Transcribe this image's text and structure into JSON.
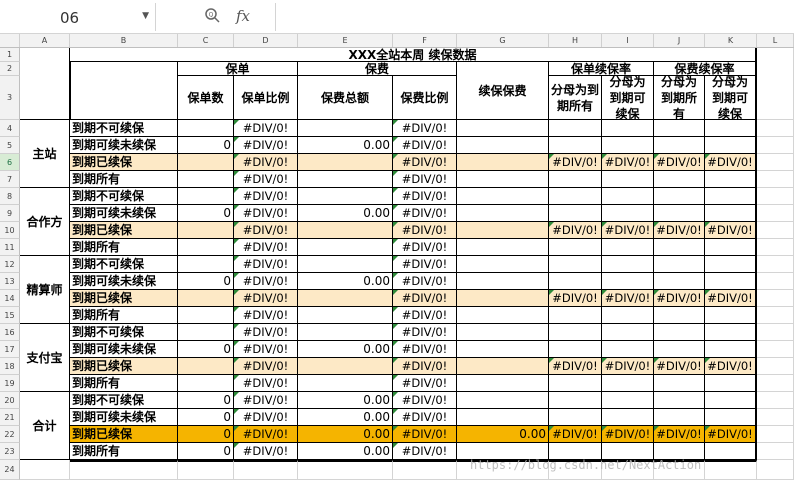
{
  "formula_bar": {
    "name_box": "06",
    "fx": "fx",
    "formula": ""
  },
  "columns": [
    "A",
    "B",
    "C",
    "D",
    "E",
    "F",
    "G",
    "H",
    "I",
    "J",
    "K",
    "L"
  ],
  "rows": [
    "1",
    "2",
    "3",
    "4",
    "5",
    "6",
    "7",
    "8",
    "9",
    "10",
    "11",
    "12",
    "13",
    "14",
    "15",
    "16",
    "17",
    "18",
    "19",
    "20",
    "21",
    "22",
    "23",
    "24"
  ],
  "sheet": {
    "title": "XXX全站本周 续保数据",
    "headers": {
      "baodan": "保单",
      "baofei": "保费",
      "xubao_baofei": "续保保费",
      "baodan_xubaolv": "保单续保率",
      "baofei_xubaolv": "保费续保率",
      "baodan_shu": "保单数",
      "baodan_bili": "保单比例",
      "baofei_zonge": "保费总额",
      "baofei_bili": "保费比例",
      "h_sub": "分母为到期所有",
      "i_sub": "分母为到期可续保",
      "j_sub": "分母为到期所有",
      "k_sub": "分母为到期可续保"
    },
    "groups": [
      {
        "name": "主站",
        "rows": [
          "到期不可续保",
          "到期可续未续保",
          "到期已续保",
          "到期所有"
        ]
      },
      {
        "name": "合作方",
        "rows": [
          "到期不可续保",
          "到期可续未续保",
          "到期已续保",
          "到期所有"
        ]
      },
      {
        "name": "精算师",
        "rows": [
          "到期不可续保",
          "到期可续未续保",
          "到期已续保",
          "到期所有"
        ]
      },
      {
        "name": "支付宝",
        "rows": [
          "到期不可续保",
          "到期可续未续保",
          "到期已续保",
          "到期所有"
        ]
      },
      {
        "name": "合计",
        "rows": [
          "到期不可续保",
          "到期可续未续保",
          "到期已续保",
          "到期所有"
        ]
      }
    ],
    "err": "#DIV/0!",
    "zero": "0",
    "zero_money": "0.00"
  },
  "watermark": "https://blog.csdn.net/NextAction",
  "colors": {
    "highlight_light": "#fde9c6",
    "highlight_strong": "#f5b400",
    "grid_dark": "#000000",
    "selected_row": "#d8ecd5"
  }
}
